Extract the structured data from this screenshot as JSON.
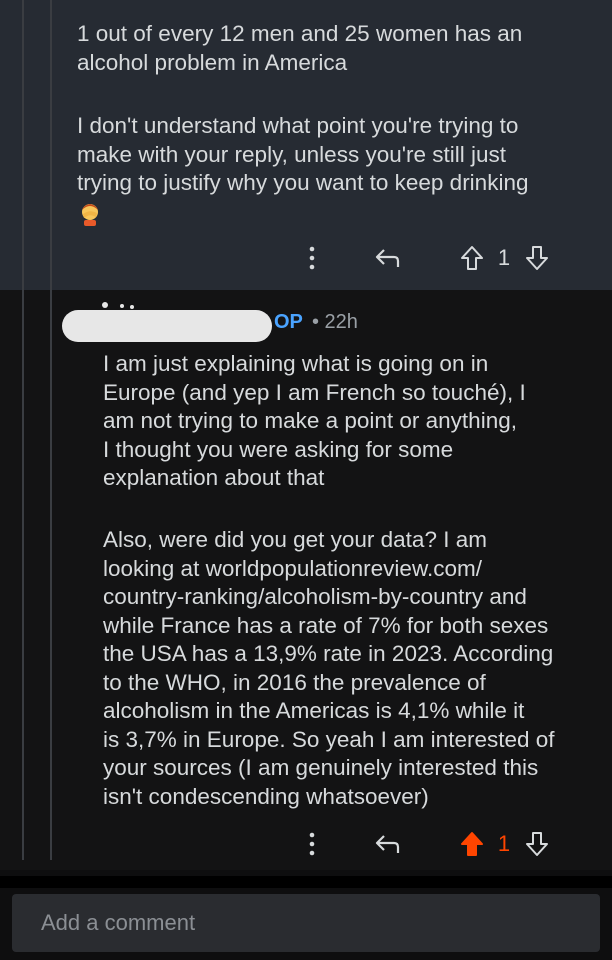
{
  "parent_comment": {
    "paragraph_1": "1 out of every 12 men and 25 women has an\nalcohol problem in America",
    "paragraph_2": "I don't understand what point you're trying to\nmake with your reply, unless you're still just\ntrying to justify why you want to keep drinking",
    "emoji": "face-palm-emoji",
    "score": "1",
    "upvoted": false
  },
  "reply_comment": {
    "author_tag": "OP",
    "time": "• 22h",
    "paragraph_1": "I  am just explaining what is going on in\nEurope (and yep I am French so touché), I\nam not trying to make a point or anything,\nI thought you were asking for some\nexplanation about that",
    "paragraph_2": "Also, were did you get your data? I am\nlooking at worldpopulationreview.com/\ncountry-ranking/alcoholism-by-country and\nwhile France has a rate of 7% for both sexes\nthe USA has a 13,9% rate in 2023. According\nto the WHO, in 2016 the prevalence of\nalcoholism in the Americas is 4,1% while it\nis 3,7% in Europe. So yeah I am interested of\nyour sources (I am genuinely interested this\nisn't condescending whatsoever)",
    "score": "1",
    "upvoted": true,
    "upvote_color": "#ff4500"
  },
  "composer": {
    "placeholder": "Add a comment"
  },
  "icons": [
    "more-icon",
    "reply-icon",
    "upvote-icon",
    "downvote-icon"
  ]
}
